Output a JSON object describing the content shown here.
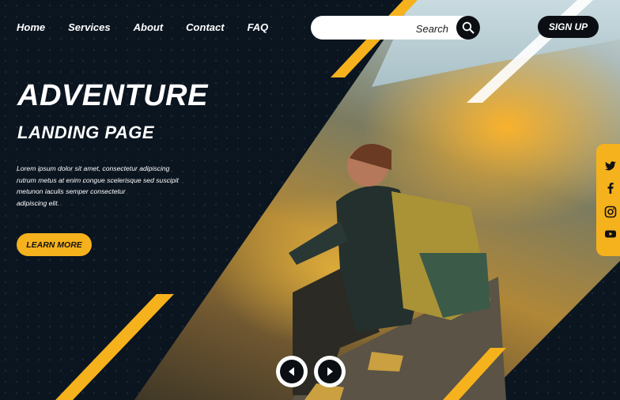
{
  "nav": {
    "items": [
      {
        "label": "Home"
      },
      {
        "label": "Services"
      },
      {
        "label": "About"
      },
      {
        "label": "Contact"
      },
      {
        "label": "FAQ"
      }
    ]
  },
  "search": {
    "placeholder": "Search",
    "icon": "search-icon"
  },
  "signup": {
    "label": "SIGN UP"
  },
  "hero": {
    "title": "ADVENTURE",
    "subtitle": "LANDING PAGE",
    "body_lines": [
      "Lorem ipsum dolor sit amet, consectetur adipiscing",
      "rutrum metus at enim congue scelerisque sed suscipit",
      "metunon iaculis semper consectetur",
      "adipiscing elit."
    ],
    "cta": "LEARN MORE"
  },
  "social": {
    "icons": [
      "twitter-icon",
      "facebook-icon",
      "instagram-icon",
      "youtube-icon"
    ]
  },
  "carousel": {
    "prev_icon": "chevron-left-icon",
    "next_icon": "chevron-right-icon"
  },
  "colors": {
    "accent": "#f5b21d",
    "background": "#0b1520",
    "dark": "#0b0f14",
    "text": "#ffffff"
  }
}
